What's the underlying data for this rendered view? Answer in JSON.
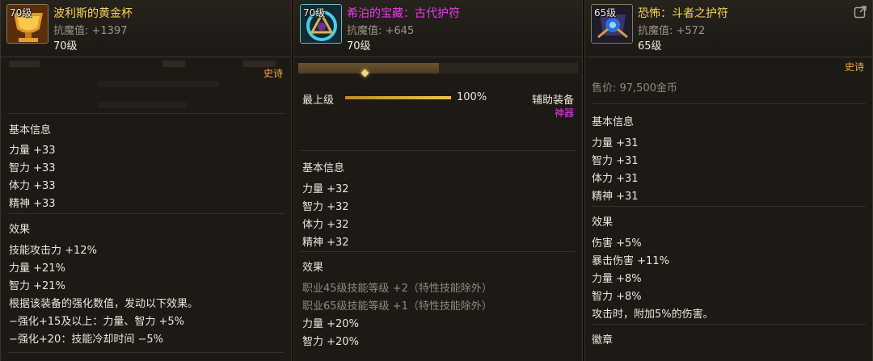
{
  "panels": [
    {
      "icon": "golden-cup-icon",
      "level_tag": "70级",
      "name": "波利斯的黄金杯",
      "magic_resist": "抗魔值: +1397",
      "level": "70级",
      "rarity": "史诗",
      "basic_title": "基本信息",
      "basic_stats": [
        "力量 +33",
        "智力 +33",
        "体力 +33",
        "精神 +33"
      ],
      "effect_title": "效果",
      "effects": [
        "技能攻击力 +12%",
        "力量 +21%",
        "智力 +21%",
        "根据该装备的强化数值，发动以下效果。",
        "−强化+15及以上：力量、智力 +5%",
        "−强化+20：技能冷却时间 −5%"
      ]
    },
    {
      "icon": "ancient-amulet-icon",
      "level_tag": "70级",
      "name": "希泊的宝藏：古代护符",
      "magic_resist": "抗魔值: +645",
      "level": "70级",
      "max_level_label": "最上级",
      "progress_percent": 100,
      "progress_text": "100%",
      "equip_type": "辅助装备",
      "rarity": "神器",
      "basic_title": "基本信息",
      "basic_stats": [
        "力量 +32",
        "智力 +32",
        "体力 +32",
        "精神 +32"
      ],
      "effect_title": "效果",
      "effects_grey": [
        "职业45级技能等级 +2（特性技能除外）",
        "职业65级技能等级 +1（特性技能除外）"
      ],
      "effects": [
        "力量 +20%",
        "智力 +20%"
      ]
    },
    {
      "icon": "fighter-amulet-icon",
      "level_tag": "65级",
      "name": "恐怖：斗者之护符",
      "magic_resist": "抗魔值: +572",
      "level": "65级",
      "rarity": "史诗",
      "price": "售价: 97,500金币",
      "basic_title": "基本信息",
      "basic_stats": [
        "力量 +31",
        "智力 +31",
        "体力 +31",
        "精神 +31"
      ],
      "effect_title": "效果",
      "effects": [
        "伤害 +5%",
        "暴击伤害 +11%",
        "力量 +8%",
        "智力 +8%",
        "攻击时，附加5%的伤害。"
      ],
      "emblem_title": "徽章"
    }
  ],
  "colors": {
    "gold_name": "#f5d35a",
    "magenta_name": "#ea3bea",
    "epic": "#f4a93a",
    "artifact": "#ea3bea"
  }
}
